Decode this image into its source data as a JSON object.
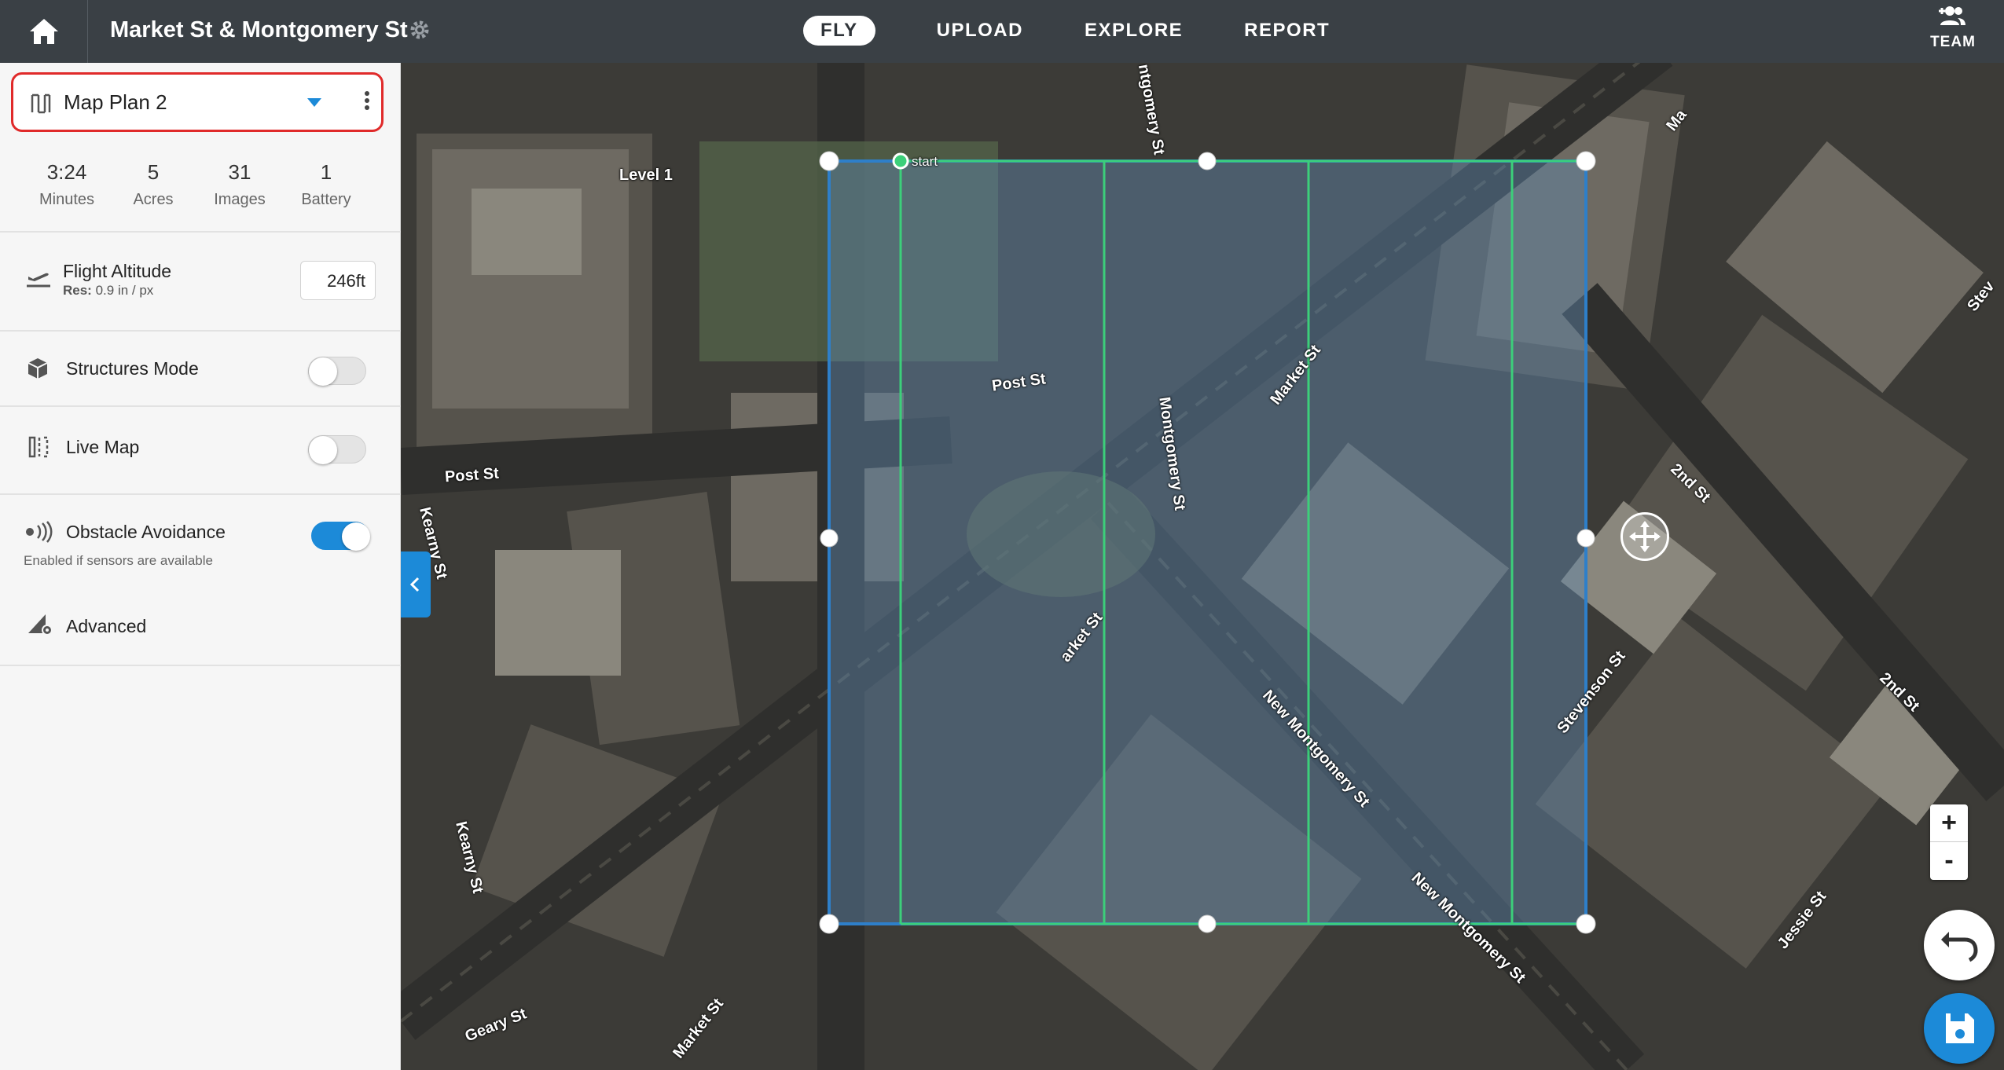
{
  "topbar": {
    "site_title": "Market St & Montgomery St",
    "nav": [
      {
        "label": "FLY",
        "active": true
      },
      {
        "label": "UPLOAD",
        "active": false
      },
      {
        "label": "EXPLORE",
        "active": false
      },
      {
        "label": "REPORT",
        "active": false
      }
    ],
    "team_label": "TEAM",
    "icons": {
      "home": "home-icon",
      "settings": "gear-icon",
      "team": "add-team-icon"
    }
  },
  "sidebar": {
    "plan_name": "Map Plan 2",
    "stats": [
      {
        "value": "3:24",
        "label": "Minutes"
      },
      {
        "value": "5",
        "label": "Acres"
      },
      {
        "value": "31",
        "label": "Images"
      },
      {
        "value": "1",
        "label": "Battery"
      }
    ],
    "flight_altitude": {
      "label": "Flight Altitude",
      "res_prefix": "Res:",
      "res_value": "0.9 in / px",
      "value": "246ft"
    },
    "structures_mode": {
      "label": "Structures Mode",
      "on": false
    },
    "live_map": {
      "label": "Live Map",
      "on": false
    },
    "obstacle_avoidance": {
      "label": "Obstacle Avoidance",
      "note": "Enabled if sensors are available",
      "on": true
    },
    "advanced": {
      "label": "Advanced"
    }
  },
  "map": {
    "labels": [
      {
        "key": "level1",
        "text": "Level 1"
      },
      {
        "key": "start",
        "text": "start"
      },
      {
        "key": "post_st_center",
        "text": "Post St"
      },
      {
        "key": "post_st_left",
        "text": "Post St"
      },
      {
        "key": "kearny_st_top",
        "text": "Kearny St"
      },
      {
        "key": "kearny_st_bottom",
        "text": "Kearny St"
      },
      {
        "key": "montgomery_st_top",
        "text": "ntgomery St"
      },
      {
        "key": "montgomery_st",
        "text": "Montgomery St"
      },
      {
        "key": "market_st_mid",
        "text": "Market St"
      },
      {
        "key": "market_st_low",
        "text": "arket St"
      },
      {
        "key": "market_st_bottom",
        "text": "Market St"
      },
      {
        "key": "market_st_top",
        "text": "Ma"
      },
      {
        "key": "new_montgomery_1",
        "text": "New Montgomery St"
      },
      {
        "key": "new_montgomery_2",
        "text": "New Montgomery St"
      },
      {
        "key": "stevenson_st",
        "text": "Stevenson St"
      },
      {
        "key": "second_st_1",
        "text": "2nd St"
      },
      {
        "key": "second_st_2",
        "text": "2nd St"
      },
      {
        "key": "jessie_st",
        "text": "Jessie St"
      },
      {
        "key": "geary_st",
        "text": "Geary St"
      },
      {
        "key": "stev_edge",
        "text": "Stev"
      }
    ],
    "zoom_in": "+",
    "zoom_out": "-",
    "colors": {
      "boundary": "#2e7fc9",
      "flight_lines": "#3ccf7a",
      "accent": "#1c8ad8",
      "highlight": "#e02a2a"
    }
  }
}
